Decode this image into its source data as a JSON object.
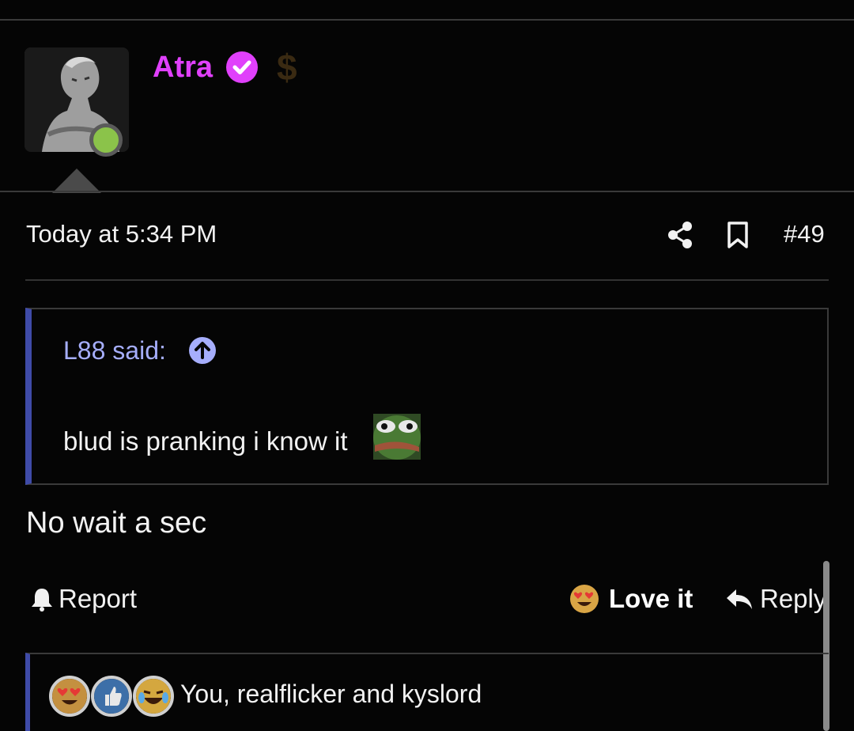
{
  "post": {
    "author": {
      "name": "Atra",
      "verified_icon": "verified-check-icon",
      "badge_icon": "dollar-icon",
      "badge_text": "$",
      "online": true,
      "name_color": "#e040fb"
    },
    "timestamp": "Today at 5:34 PM",
    "share_icon": "share-icon",
    "bookmark_icon": "bookmark-icon",
    "number": "#49",
    "quote": {
      "author": "L88 said:",
      "arrow_icon": "arrow-up-circle-icon",
      "text": "blud is pranking i know it",
      "emoji": "pepe-emoji"
    },
    "message": "No wait a sec",
    "actions": {
      "report": "Report",
      "love": "Love it",
      "reply": "Reply"
    },
    "reactions": {
      "icons": [
        "heart-eyes-emoji",
        "thumbs-up-emoji",
        "laughing-crying-emoji"
      ],
      "summary": "You, realflicker and kyslord"
    }
  },
  "colors": {
    "accent_quote": "#3f4ba8",
    "quote_author": "#a6aefc",
    "online": "#8bc34a",
    "background": "#050505"
  }
}
